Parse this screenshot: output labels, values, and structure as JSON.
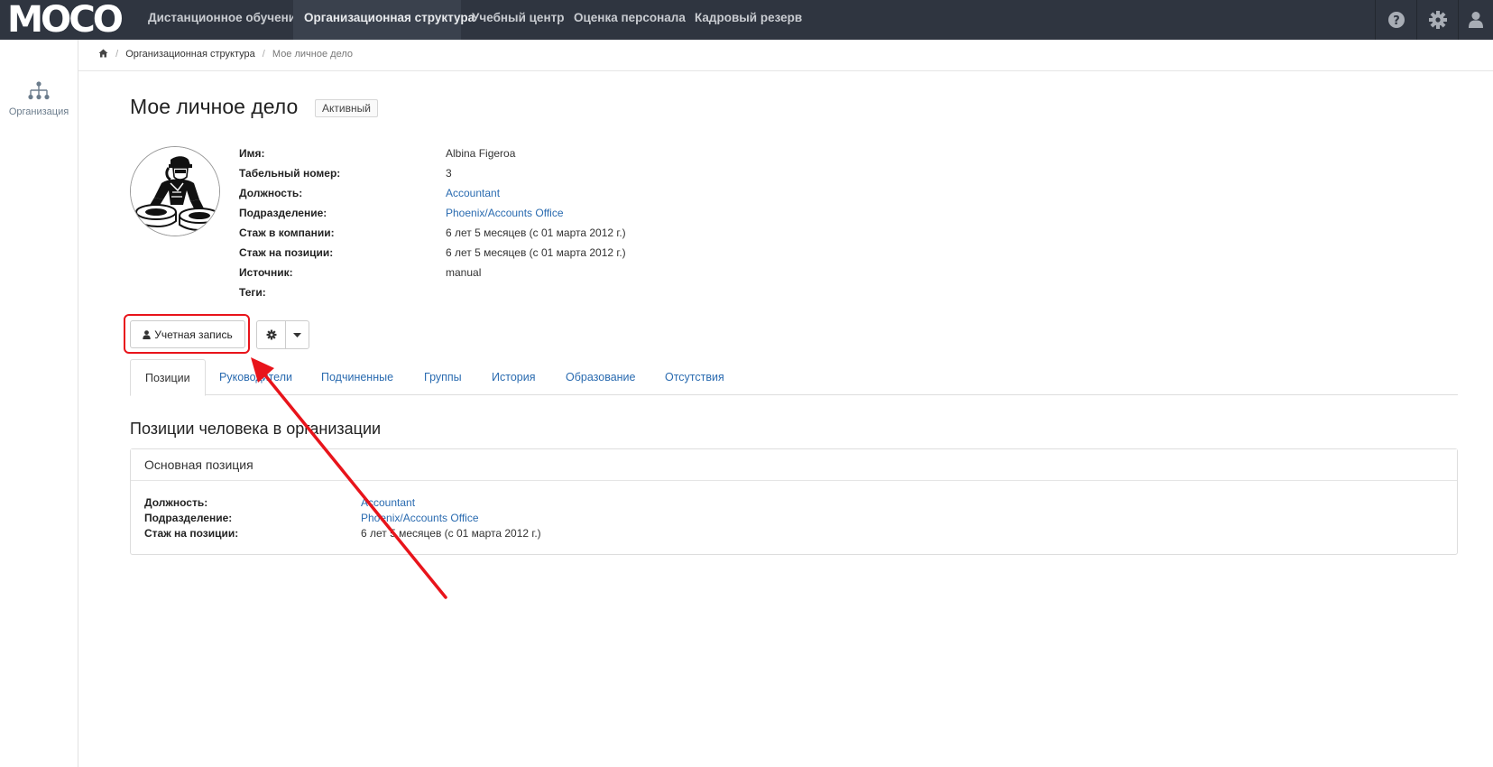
{
  "navbar": {
    "logo_text": "MOCO",
    "items": [
      {
        "label": "Дистанционное обучение",
        "active": false
      },
      {
        "label": "Организационная структура",
        "active": true
      },
      {
        "label": "Учебный центр",
        "active": false
      },
      {
        "label": "Оценка персонала",
        "active": false
      },
      {
        "label": "Кадровый резерв",
        "active": false
      }
    ],
    "right_icons": [
      "help-icon",
      "gear-icon",
      "user-icon"
    ]
  },
  "sidebar": {
    "items": [
      {
        "label": "Организация",
        "icon": "org-chart-icon"
      }
    ]
  },
  "breadcrumb": {
    "home_icon": "home-icon",
    "items": [
      "Организационная структура",
      "Мое личное дело"
    ]
  },
  "profile": {
    "title": "Мое личное дело",
    "status": "Активный",
    "fields": [
      {
        "label": "Имя:",
        "value": "Albina Figeroa",
        "link": false
      },
      {
        "label": "Табельный номер:",
        "value": "3",
        "link": false
      },
      {
        "label": "Должность:",
        "value": "Accountant",
        "link": true
      },
      {
        "label": "Подразделение:",
        "value": "Phoenix/Accounts Office",
        "link": true
      },
      {
        "label": "Стаж в компании:",
        "value": "6 лет 5 месяцев (с 01 марта 2012 г.)",
        "link": false
      },
      {
        "label": "Стаж на позиции:",
        "value": "6 лет 5 месяцев (с 01 марта 2012 г.)",
        "link": false
      },
      {
        "label": "Источник:",
        "value": "manual",
        "link": false
      },
      {
        "label": "Теги:",
        "value": "",
        "link": false
      }
    ]
  },
  "actions": {
    "account_button": "Учетная запись"
  },
  "tabs": [
    {
      "label": "Позиции",
      "active": true
    },
    {
      "label": "Руководители",
      "active": false
    },
    {
      "label": "Подчиненные",
      "active": false
    },
    {
      "label": "Группы",
      "active": false
    },
    {
      "label": "История",
      "active": false
    },
    {
      "label": "Образование",
      "active": false
    },
    {
      "label": "Отсутствия",
      "active": false
    }
  ],
  "positions": {
    "section_title": "Позиции человека в организации",
    "panel_title": "Основная позиция",
    "rows": [
      {
        "label": "Должность:",
        "value": "Accountant",
        "link": true
      },
      {
        "label": "Подразделение:",
        "value": "Phoenix/Accounts Office",
        "link": true
      },
      {
        "label": "Стаж на позиции:",
        "value": "6 лет 5 месяцев (с 01 марта 2012 г.)",
        "link": false
      }
    ]
  },
  "colors": {
    "navbar_bg": "#2f3540",
    "link": "#2a6bb0",
    "annotation": "#e8141b"
  }
}
